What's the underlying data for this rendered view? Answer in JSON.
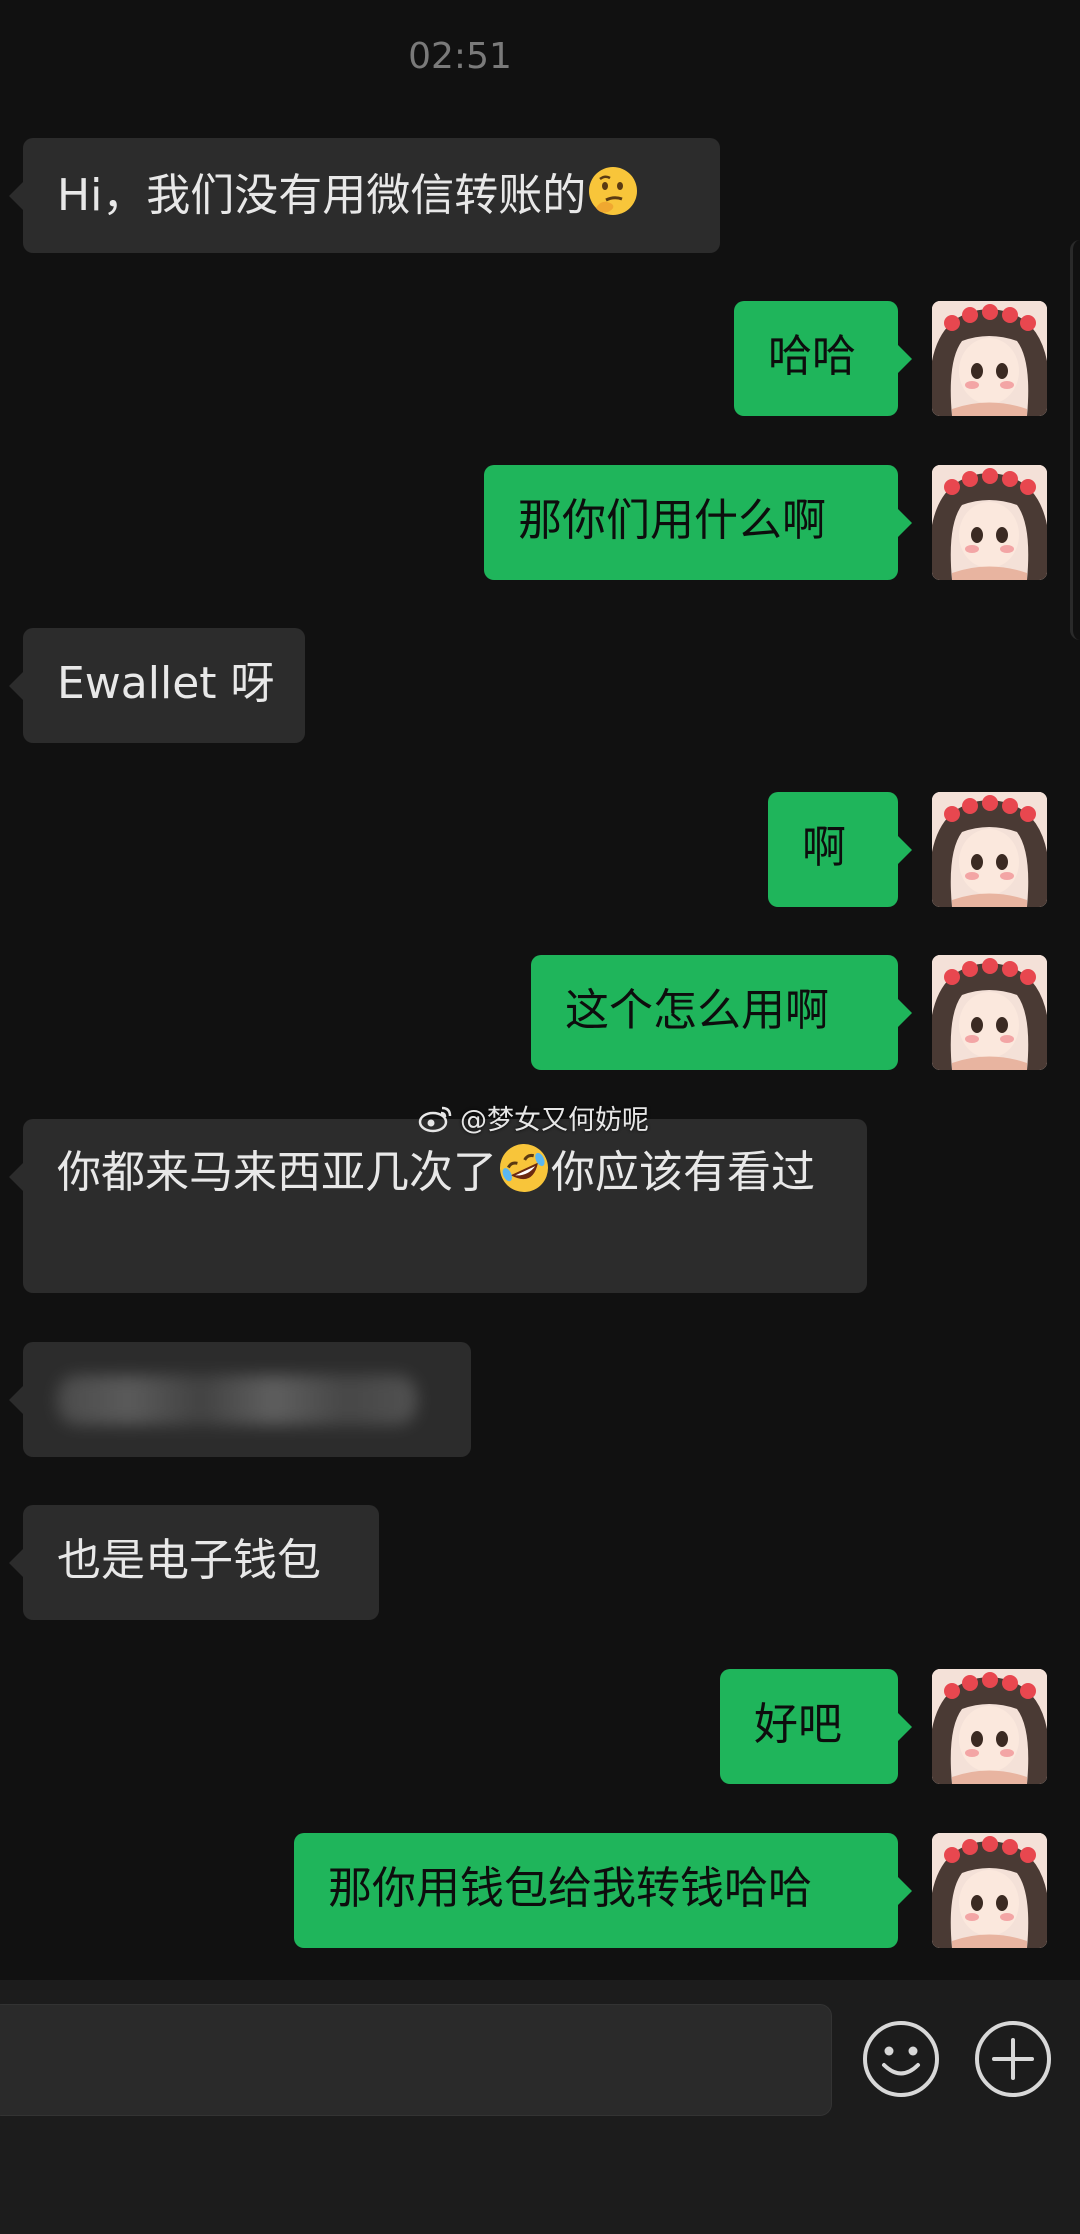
{
  "timestamp": "02:51",
  "watermark": "@梦女又何妨呢",
  "messages": [
    {
      "side": "in",
      "text": "Hi，我们没有用微信转账的",
      "emoji": "thinking-face"
    },
    {
      "side": "out",
      "text": "哈哈"
    },
    {
      "side": "out",
      "text": "那你们用什么啊"
    },
    {
      "side": "in",
      "text": "Ewallet 呀"
    },
    {
      "side": "out",
      "text": "啊"
    },
    {
      "side": "out",
      "text": "这个怎么用啊"
    },
    {
      "side": "in",
      "text_part1": "你都来马来西亚几次了",
      "text_part2": "你应该有看过",
      "emoji": "rolling-laughing-face"
    },
    {
      "side": "in",
      "text": "",
      "blurred": true
    },
    {
      "side": "in",
      "text": "也是电子钱包"
    },
    {
      "side": "out",
      "text": "好吧"
    },
    {
      "side": "out",
      "text": "那你用钱包给我转钱哈哈"
    }
  ],
  "input_bar": {
    "input_value": "",
    "emoji_button_icon": "smiley-face-icon",
    "plus_button_icon": "plus-circle-icon"
  },
  "colors": {
    "background": "#111111",
    "incoming_bubble": "#2c2c2c",
    "outgoing_bubble": "#1fb55b"
  }
}
